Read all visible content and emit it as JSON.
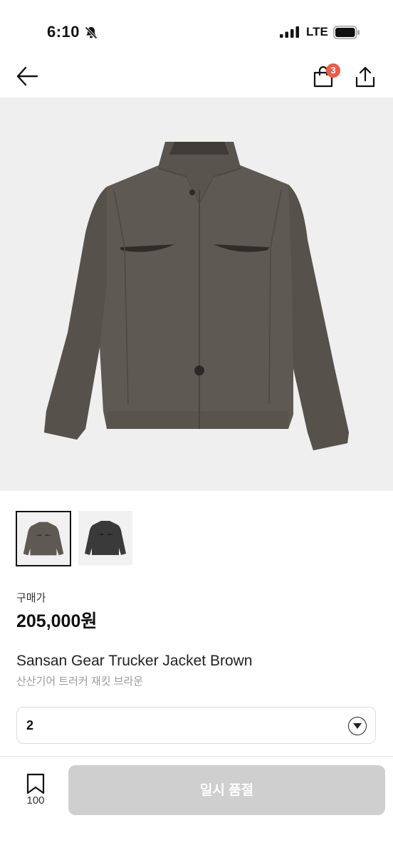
{
  "status_bar": {
    "time": "6:10",
    "network": "LTE"
  },
  "nav": {
    "cart_count": "3"
  },
  "product": {
    "price_label": "구매가",
    "price": "205,000원",
    "name_en": "Sansan Gear Trucker Jacket Brown",
    "name_ko": "산산기어 트러커 재킷 브라운",
    "colors": {
      "main": "#5f5953",
      "alt": "#3a3a3a",
      "background": "#efefef"
    }
  },
  "size_select": {
    "value": "2"
  },
  "footer": {
    "bookmark_count": "100",
    "action_label": "일시 품절"
  },
  "colors": {
    "badge": "#ef5a4a",
    "disabled_button": "#cfcfcf"
  }
}
